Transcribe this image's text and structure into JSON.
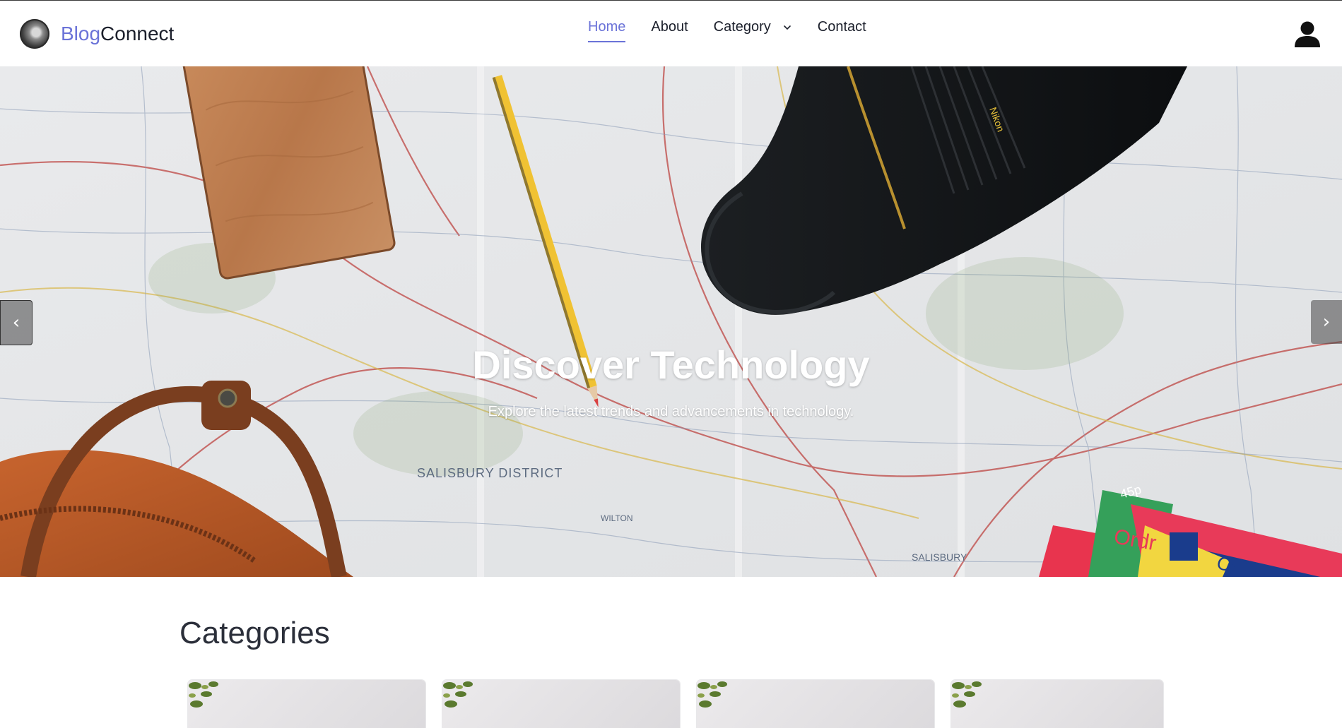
{
  "brand": {
    "part1": "Blog",
    "part2": "Connect"
  },
  "nav": {
    "home": "Home",
    "about": "About",
    "category": "Category",
    "contact": "Contact"
  },
  "hero": {
    "title": "Discover Technology",
    "subtitle": "Explore the latest trends and advancements in technology."
  },
  "categories": {
    "title": "Categories"
  },
  "colors": {
    "accent": "#6b73d8",
    "text": "#1b1f2b"
  },
  "icons": {
    "user": "user-icon",
    "chevron": "chevron-down-icon",
    "prev": "chevron-left-icon",
    "next": "chevron-right-icon"
  }
}
